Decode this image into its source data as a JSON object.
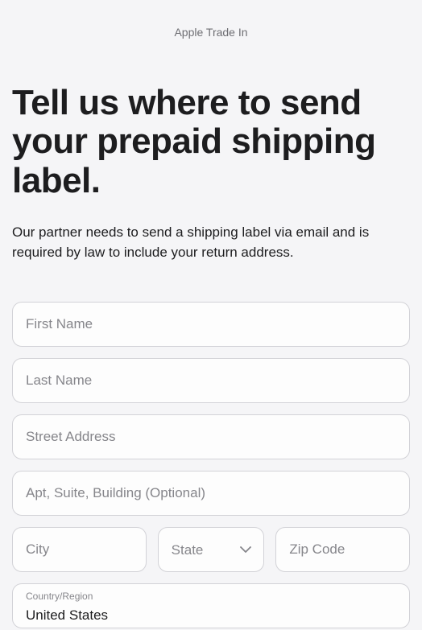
{
  "breadcrumb": "Apple Trade In",
  "heading": "Tell us where to send your prepaid shipping label.",
  "description": "Our partner needs to send a shipping label via email and is required by law to include your return address.",
  "form": {
    "firstName": {
      "placeholder": "First Name",
      "value": ""
    },
    "lastName": {
      "placeholder": "Last Name",
      "value": ""
    },
    "streetAddress": {
      "placeholder": "Street Address",
      "value": ""
    },
    "apt": {
      "placeholder": "Apt, Suite, Building (Optional)",
      "value": ""
    },
    "city": {
      "placeholder": "City",
      "value": ""
    },
    "state": {
      "placeholder": "State",
      "value": ""
    },
    "zipCode": {
      "placeholder": "Zip Code",
      "value": ""
    },
    "country": {
      "label": "Country/Region",
      "value": "United States"
    }
  }
}
